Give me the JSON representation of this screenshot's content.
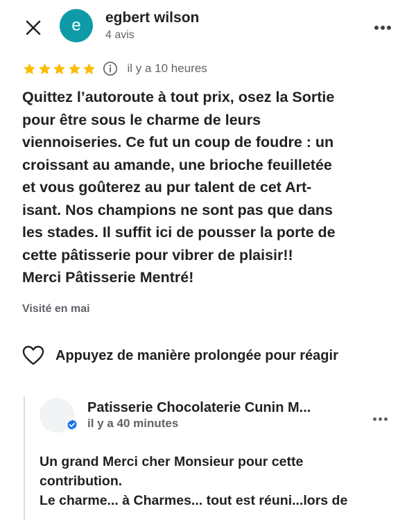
{
  "header": {
    "avatar_initial": "e",
    "author_name": "egbert wilson",
    "review_count": "4 avis",
    "avatar_color": "#0e9aa7"
  },
  "rating": {
    "stars": 5,
    "max_stars": 5,
    "star_color": "#fbbc04",
    "time_ago": "il y a 10 heures"
  },
  "review": {
    "text": "Quittez l’autoroute à tout prix, osez la Sortie\npour être sous le charme de leurs\nviennoiseries.  Ce fut un coup de foudre : un\ncroissant au amande, une brioche feuilletée\net vous goûterez au pur talent de cet Art-\nisant. Nos champions ne sont pas que dans\nles stades. Il suffit ici de pousser la porte de\ncette pâtisserie pour vibrer de plaisir!!\nMerci Pâtisserie Mentré!",
    "visited": "Visité en mai"
  },
  "react": {
    "label": "Appuyez de manière prolongée pour réagir"
  },
  "owner_reply": {
    "name": "Patisserie Chocolaterie Cunin M...",
    "time_ago": "il y a 40 minutes",
    "verified_color": "#1a73e8",
    "text": "Un grand Merci cher Monsieur pour cette\ncontribution.\nLe charme... à Charmes... tout est réuni...lors de"
  }
}
